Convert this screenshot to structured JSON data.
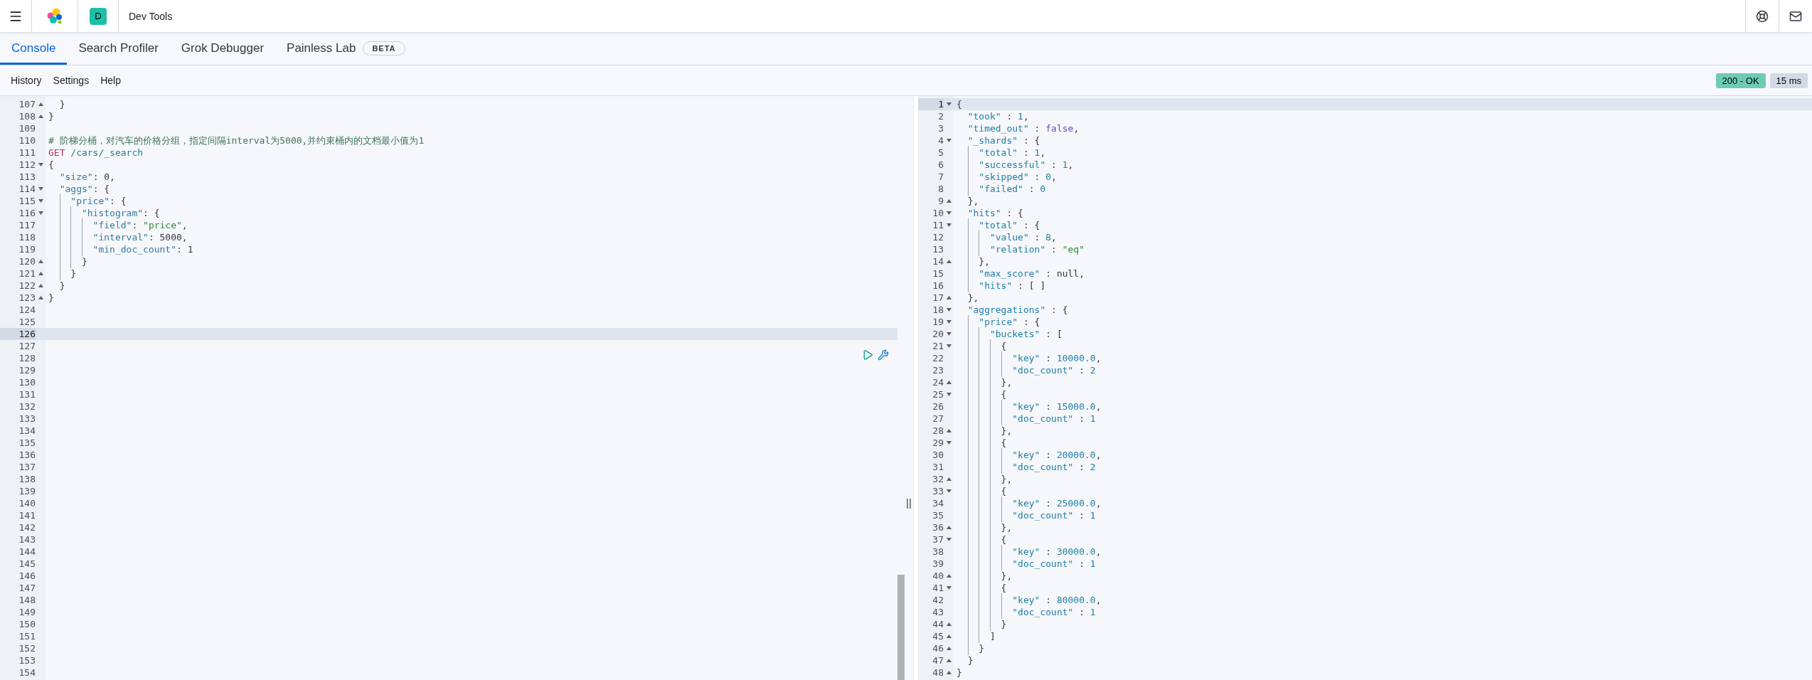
{
  "header": {
    "space_badge": "D",
    "title": "Dev Tools"
  },
  "tabs": [
    {
      "label": "Console",
      "selected": true
    },
    {
      "label": "Search Profiler",
      "selected": false
    },
    {
      "label": "Grok Debugger",
      "selected": false
    },
    {
      "label": "Painless Lab",
      "selected": false,
      "badge": "BETA"
    }
  ],
  "toolbar": {
    "links": [
      "History",
      "Settings",
      "Help"
    ],
    "status": "200 - OK",
    "duration": "15 ms"
  },
  "request_editor": {
    "lines": [
      {
        "number": "107",
        "kind": "fold-end",
        "active": false,
        "tokens": [
          {
            "kind": "punct",
            "text": "  }"
          }
        ]
      },
      {
        "number": "108",
        "kind": "fold-end",
        "active": false,
        "tokens": [
          {
            "kind": "punct",
            "text": "}"
          }
        ]
      },
      {
        "number": "109",
        "kind": "plain",
        "active": false
      },
      {
        "number": "110",
        "kind": "plain",
        "active": false,
        "tokens": [
          {
            "kind": "comment",
            "text": "# 阶梯分桶，对汽车的价格分组，指定间隔interval为5000,并约束桶内的文档最小值为1"
          }
        ]
      },
      {
        "number": "111",
        "kind": "plain",
        "active": false,
        "tokens": [
          {
            "kind": "method",
            "text": "GET"
          },
          {
            "kind": "url",
            "text": " /cars/_search"
          }
        ]
      },
      {
        "number": "112",
        "kind": "fold-start",
        "active": false,
        "tokens": [
          {
            "kind": "punct",
            "text": "{"
          }
        ]
      },
      {
        "number": "113",
        "kind": "plain",
        "active": false,
        "tokens": [
          {
            "kind": "key",
            "text": "  \"size\""
          },
          {
            "kind": "punct",
            "text": ": 0,"
          }
        ]
      },
      {
        "number": "114",
        "kind": "fold-start",
        "active": false,
        "tokens": [
          {
            "kind": "key",
            "text": "  \"aggs\""
          },
          {
            "kind": "punct",
            "text": ": {"
          }
        ]
      },
      {
        "number": "115",
        "kind": "fold-start",
        "active": false,
        "tokens": [
          {
            "kind": "key",
            "text": "    \"price\""
          },
          {
            "kind": "punct",
            "text": ": {"
          }
        ]
      },
      {
        "number": "116",
        "kind": "fold-start",
        "active": false,
        "tokens": [
          {
            "kind": "key",
            "text": "      \"histogram\""
          },
          {
            "kind": "punct",
            "text": ": {"
          }
        ]
      },
      {
        "number": "117",
        "kind": "plain",
        "active": false,
        "tokens": [
          {
            "kind": "key",
            "text": "        \"field\""
          },
          {
            "kind": "punct",
            "text": ": "
          },
          {
            "kind": "string",
            "text": "\"price\""
          },
          {
            "kind": "punct",
            "text": ","
          }
        ]
      },
      {
        "number": "118",
        "kind": "plain",
        "active": false,
        "tokens": [
          {
            "kind": "key",
            "text": "        \"interval\""
          },
          {
            "kind": "punct",
            "text": ": 5000,"
          }
        ]
      },
      {
        "number": "119",
        "kind": "plain",
        "active": false,
        "tokens": [
          {
            "kind": "key",
            "text": "        \"min_doc_count\""
          },
          {
            "kind": "punct",
            "text": ": 1"
          }
        ]
      },
      {
        "number": "120",
        "kind": "fold-end",
        "active": false,
        "tokens": [
          {
            "kind": "punct",
            "text": "      }"
          }
        ]
      },
      {
        "number": "121",
        "kind": "fold-end",
        "active": false,
        "tokens": [
          {
            "kind": "punct",
            "text": "    }"
          }
        ]
      },
      {
        "number": "122",
        "kind": "fold-end",
        "active": false,
        "tokens": [
          {
            "kind": "punct",
            "text": "  }"
          }
        ]
      },
      {
        "number": "123",
        "kind": "fold-end",
        "active": false,
        "tokens": [
          {
            "kind": "punct",
            "text": "}"
          }
        ]
      },
      {
        "number": "124",
        "kind": "plain",
        "active": false
      },
      {
        "number": "125",
        "kind": "plain",
        "active": false
      },
      {
        "number": "126",
        "kind": "plain",
        "active": true
      },
      {
        "number": "127",
        "kind": "plain",
        "active": false
      },
      {
        "number": "128",
        "kind": "plain",
        "active": false
      },
      {
        "number": "129",
        "kind": "plain",
        "active": false
      },
      {
        "number": "130",
        "kind": "plain",
        "active": false
      },
      {
        "number": "131",
        "kind": "plain",
        "active": false
      },
      {
        "number": "132",
        "kind": "plain",
        "active": false
      },
      {
        "number": "133",
        "kind": "plain",
        "active": false
      },
      {
        "number": "134",
        "kind": "plain",
        "active": false
      },
      {
        "number": "135",
        "kind": "plain",
        "active": false
      },
      {
        "number": "136",
        "kind": "plain",
        "active": false
      },
      {
        "number": "137",
        "kind": "plain",
        "active": false
      },
      {
        "number": "138",
        "kind": "plain",
        "active": false
      },
      {
        "number": "139",
        "kind": "plain",
        "active": false
      },
      {
        "number": "140",
        "kind": "plain",
        "active": false
      },
      {
        "number": "141",
        "kind": "plain",
        "active": false
      },
      {
        "number": "142",
        "kind": "plain",
        "active": false
      },
      {
        "number": "143",
        "kind": "plain",
        "active": false
      },
      {
        "number": "144",
        "kind": "plain",
        "active": false
      },
      {
        "number": "145",
        "kind": "plain",
        "active": false
      },
      {
        "number": "146",
        "kind": "plain",
        "active": false
      },
      {
        "number": "147",
        "kind": "plain",
        "active": false
      },
      {
        "number": "148",
        "kind": "plain",
        "active": false
      },
      {
        "number": "149",
        "kind": "plain",
        "active": false
      },
      {
        "number": "150",
        "kind": "plain",
        "active": false
      },
      {
        "number": "151",
        "kind": "plain",
        "active": false
      },
      {
        "number": "152",
        "kind": "plain",
        "active": false
      },
      {
        "number": "153",
        "kind": "plain",
        "active": false
      },
      {
        "number": "154",
        "kind": "plain",
        "active": false
      }
    ]
  },
  "response_viewer": {
    "lines": [
      {
        "number": "1",
        "kind": "fold-start",
        "active": true,
        "tokens": [
          {
            "kind": "punct",
            "text": "{"
          }
        ]
      },
      {
        "number": "2",
        "kind": "plain",
        "active": false,
        "tokens": [
          {
            "kind": "rkey",
            "text": "  \"took\""
          },
          {
            "kind": "punct",
            "text": " : "
          },
          {
            "kind": "value",
            "text": "1"
          },
          {
            "kind": "punct",
            "text": ","
          }
        ]
      },
      {
        "number": "3",
        "kind": "plain",
        "active": false,
        "tokens": [
          {
            "kind": "rkey",
            "text": "  \"timed_out\""
          },
          {
            "kind": "punct",
            "text": " : "
          },
          {
            "kind": "bool",
            "text": "false"
          },
          {
            "kind": "punct",
            "text": ","
          }
        ]
      },
      {
        "number": "4",
        "kind": "fold-start",
        "active": false,
        "tokens": [
          {
            "kind": "rkey",
            "text": "  \"_shards\""
          },
          {
            "kind": "punct",
            "text": " : {"
          }
        ]
      },
      {
        "number": "5",
        "kind": "plain",
        "active": false,
        "tokens": [
          {
            "kind": "rkey",
            "text": "    \"total\""
          },
          {
            "kind": "punct",
            "text": " : "
          },
          {
            "kind": "value",
            "text": "1"
          },
          {
            "kind": "punct",
            "text": ","
          }
        ]
      },
      {
        "number": "6",
        "kind": "plain",
        "active": false,
        "tokens": [
          {
            "kind": "rkey",
            "text": "    \"successful\""
          },
          {
            "kind": "punct",
            "text": " : "
          },
          {
            "kind": "value",
            "text": "1"
          },
          {
            "kind": "punct",
            "text": ","
          }
        ]
      },
      {
        "number": "7",
        "kind": "plain",
        "active": false,
        "tokens": [
          {
            "kind": "rkey",
            "text": "    \"skipped\""
          },
          {
            "kind": "punct",
            "text": " : "
          },
          {
            "kind": "value",
            "text": "0"
          },
          {
            "kind": "punct",
            "text": ","
          }
        ]
      },
      {
        "number": "8",
        "kind": "plain",
        "active": false,
        "tokens": [
          {
            "kind": "rkey",
            "text": "    \"failed\""
          },
          {
            "kind": "punct",
            "text": " : "
          },
          {
            "kind": "value",
            "text": "0"
          }
        ]
      },
      {
        "number": "9",
        "kind": "fold-end",
        "active": false,
        "tokens": [
          {
            "kind": "punct",
            "text": "  },"
          }
        ]
      },
      {
        "number": "10",
        "kind": "fold-start",
        "active": false,
        "tokens": [
          {
            "kind": "rkey",
            "text": "  \"hits\""
          },
          {
            "kind": "punct",
            "text": " : {"
          }
        ]
      },
      {
        "number": "11",
        "kind": "fold-start",
        "active": false,
        "tokens": [
          {
            "kind": "rkey",
            "text": "    \"total\""
          },
          {
            "kind": "punct",
            "text": " : {"
          }
        ]
      },
      {
        "number": "12",
        "kind": "plain",
        "active": false,
        "tokens": [
          {
            "kind": "rkey",
            "text": "      \"value\""
          },
          {
            "kind": "punct",
            "text": " : "
          },
          {
            "kind": "value",
            "text": "8"
          },
          {
            "kind": "punct",
            "text": ","
          }
        ]
      },
      {
        "number": "13",
        "kind": "plain",
        "active": false,
        "tokens": [
          {
            "kind": "rkey",
            "text": "      \"relation\""
          },
          {
            "kind": "punct",
            "text": " : "
          },
          {
            "kind": "string",
            "text": "\"eq\""
          }
        ]
      },
      {
        "number": "14",
        "kind": "fold-end",
        "active": false,
        "tokens": [
          {
            "kind": "punct",
            "text": "    },"
          }
        ]
      },
      {
        "number": "15",
        "kind": "plain",
        "active": false,
        "tokens": [
          {
            "kind": "rkey",
            "text": "    \"max_score\""
          },
          {
            "kind": "punct",
            "text": " : null,"
          }
        ]
      },
      {
        "number": "16",
        "kind": "plain",
        "active": false,
        "tokens": [
          {
            "kind": "rkey",
            "text": "    \"hits\""
          },
          {
            "kind": "punct",
            "text": " : [ ]"
          }
        ]
      },
      {
        "number": "17",
        "kind": "fold-end",
        "active": false,
        "tokens": [
          {
            "kind": "punct",
            "text": "  },"
          }
        ]
      },
      {
        "number": "18",
        "kind": "fold-start",
        "active": false,
        "tokens": [
          {
            "kind": "rkey",
            "text": "  \"aggregations\""
          },
          {
            "kind": "punct",
            "text": " : {"
          }
        ]
      },
      {
        "number": "19",
        "kind": "fold-start",
        "active": false,
        "tokens": [
          {
            "kind": "rkey",
            "text": "    \"price\""
          },
          {
            "kind": "punct",
            "text": " : {"
          }
        ]
      },
      {
        "number": "20",
        "kind": "fold-start",
        "active": false,
        "tokens": [
          {
            "kind": "rkey",
            "text": "      \"buckets\""
          },
          {
            "kind": "punct",
            "text": " : ["
          }
        ]
      },
      {
        "number": "21",
        "kind": "fold-start",
        "active": false,
        "tokens": [
          {
            "kind": "punct",
            "text": "        {"
          }
        ]
      },
      {
        "number": "22",
        "kind": "plain",
        "active": false,
        "tokens": [
          {
            "kind": "rkey",
            "text": "          \"key\""
          },
          {
            "kind": "punct",
            "text": " : "
          },
          {
            "kind": "value",
            "text": "10000.0"
          },
          {
            "kind": "punct",
            "text": ","
          }
        ]
      },
      {
        "number": "23",
        "kind": "plain",
        "active": false,
        "tokens": [
          {
            "kind": "rkey",
            "text": "          \"doc_count\""
          },
          {
            "kind": "punct",
            "text": " : "
          },
          {
            "kind": "value",
            "text": "2"
          }
        ]
      },
      {
        "number": "24",
        "kind": "fold-end",
        "active": false,
        "tokens": [
          {
            "kind": "punct",
            "text": "        },"
          }
        ]
      },
      {
        "number": "25",
        "kind": "fold-start",
        "active": false,
        "tokens": [
          {
            "kind": "punct",
            "text": "        {"
          }
        ]
      },
      {
        "number": "26",
        "kind": "plain",
        "active": false,
        "tokens": [
          {
            "kind": "rkey",
            "text": "          \"key\""
          },
          {
            "kind": "punct",
            "text": " : "
          },
          {
            "kind": "value",
            "text": "15000.0"
          },
          {
            "kind": "punct",
            "text": ","
          }
        ]
      },
      {
        "number": "27",
        "kind": "plain",
        "active": false,
        "tokens": [
          {
            "kind": "rkey",
            "text": "          \"doc_count\""
          },
          {
            "kind": "punct",
            "text": " : "
          },
          {
            "kind": "value",
            "text": "1"
          }
        ]
      },
      {
        "number": "28",
        "kind": "fold-end",
        "active": false,
        "tokens": [
          {
            "kind": "punct",
            "text": "        },"
          }
        ]
      },
      {
        "number": "29",
        "kind": "fold-start",
        "active": false,
        "tokens": [
          {
            "kind": "punct",
            "text": "        {"
          }
        ]
      },
      {
        "number": "30",
        "kind": "plain",
        "active": false,
        "tokens": [
          {
            "kind": "rkey",
            "text": "          \"key\""
          },
          {
            "kind": "punct",
            "text": " : "
          },
          {
            "kind": "value",
            "text": "20000.0"
          },
          {
            "kind": "punct",
            "text": ","
          }
        ]
      },
      {
        "number": "31",
        "kind": "plain",
        "active": false,
        "tokens": [
          {
            "kind": "rkey",
            "text": "          \"doc_count\""
          },
          {
            "kind": "punct",
            "text": " : "
          },
          {
            "kind": "value",
            "text": "2"
          }
        ]
      },
      {
        "number": "32",
        "kind": "fold-end",
        "active": false,
        "tokens": [
          {
            "kind": "punct",
            "text": "        },"
          }
        ]
      },
      {
        "number": "33",
        "kind": "fold-start",
        "active": false,
        "tokens": [
          {
            "kind": "punct",
            "text": "        {"
          }
        ]
      },
      {
        "number": "34",
        "kind": "plain",
        "active": false,
        "tokens": [
          {
            "kind": "rkey",
            "text": "          \"key\""
          },
          {
            "kind": "punct",
            "text": " : "
          },
          {
            "kind": "value",
            "text": "25000.0"
          },
          {
            "kind": "punct",
            "text": ","
          }
        ]
      },
      {
        "number": "35",
        "kind": "plain",
        "active": false,
        "tokens": [
          {
            "kind": "rkey",
            "text": "          \"doc_count\""
          },
          {
            "kind": "punct",
            "text": " : "
          },
          {
            "kind": "value",
            "text": "1"
          }
        ]
      },
      {
        "number": "36",
        "kind": "fold-end",
        "active": false,
        "tokens": [
          {
            "kind": "punct",
            "text": "        },"
          }
        ]
      },
      {
        "number": "37",
        "kind": "fold-start",
        "active": false,
        "tokens": [
          {
            "kind": "punct",
            "text": "        {"
          }
        ]
      },
      {
        "number": "38",
        "kind": "plain",
        "active": false,
        "tokens": [
          {
            "kind": "rkey",
            "text": "          \"key\""
          },
          {
            "kind": "punct",
            "text": " : "
          },
          {
            "kind": "value",
            "text": "30000.0"
          },
          {
            "kind": "punct",
            "text": ","
          }
        ]
      },
      {
        "number": "39",
        "kind": "plain",
        "active": false,
        "tokens": [
          {
            "kind": "rkey",
            "text": "          \"doc_count\""
          },
          {
            "kind": "punct",
            "text": " : "
          },
          {
            "kind": "value",
            "text": "1"
          }
        ]
      },
      {
        "number": "40",
        "kind": "fold-end",
        "active": false,
        "tokens": [
          {
            "kind": "punct",
            "text": "        },"
          }
        ]
      },
      {
        "number": "41",
        "kind": "fold-start",
        "active": false,
        "tokens": [
          {
            "kind": "punct",
            "text": "        {"
          }
        ]
      },
      {
        "number": "42",
        "kind": "plain",
        "active": false,
        "tokens": [
          {
            "kind": "rkey",
            "text": "          \"key\""
          },
          {
            "kind": "punct",
            "text": " : "
          },
          {
            "kind": "value",
            "text": "80000.0"
          },
          {
            "kind": "punct",
            "text": ","
          }
        ]
      },
      {
        "number": "43",
        "kind": "plain",
        "active": false,
        "tokens": [
          {
            "kind": "rkey",
            "text": "          \"doc_count\""
          },
          {
            "kind": "punct",
            "text": " : "
          },
          {
            "kind": "value",
            "text": "1"
          }
        ]
      },
      {
        "number": "44",
        "kind": "fold-end",
        "active": false,
        "tokens": [
          {
            "kind": "punct",
            "text": "        }"
          }
        ]
      },
      {
        "number": "45",
        "kind": "fold-end",
        "active": false,
        "tokens": [
          {
            "kind": "punct",
            "text": "      ]"
          }
        ]
      },
      {
        "number": "46",
        "kind": "fold-end",
        "active": false,
        "tokens": [
          {
            "kind": "punct",
            "text": "    }"
          }
        ]
      },
      {
        "number": "47",
        "kind": "fold-end",
        "active": false,
        "tokens": [
          {
            "kind": "punct",
            "text": "  }"
          }
        ]
      },
      {
        "number": "48",
        "kind": "fold-end",
        "active": false,
        "tokens": [
          {
            "kind": "punct",
            "text": "}"
          }
        ]
      }
    ]
  }
}
